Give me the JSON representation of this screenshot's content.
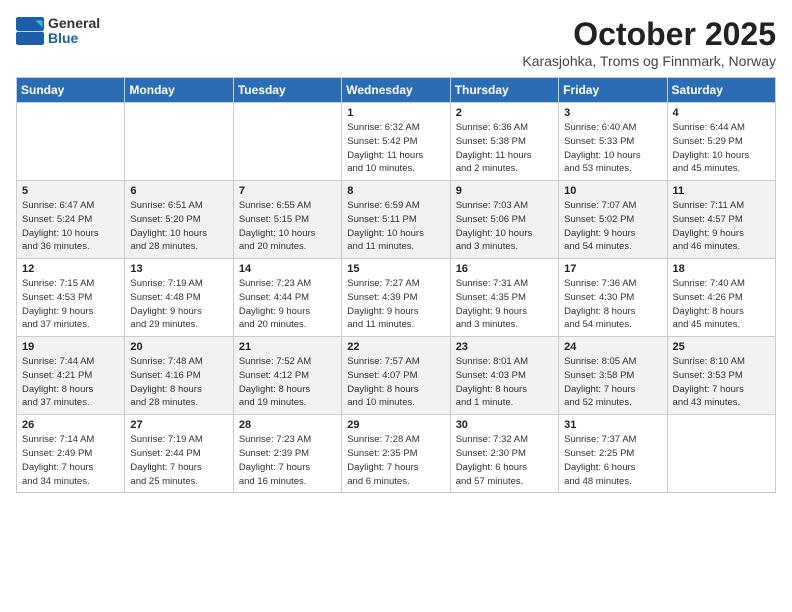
{
  "logo": {
    "general": "General",
    "blue": "Blue"
  },
  "title": "October 2025",
  "subtitle": "Karasjohka, Troms og Finnmark, Norway",
  "days_header": [
    "Sunday",
    "Monday",
    "Tuesday",
    "Wednesday",
    "Thursday",
    "Friday",
    "Saturday"
  ],
  "weeks": [
    [
      {
        "num": "",
        "detail": ""
      },
      {
        "num": "",
        "detail": ""
      },
      {
        "num": "",
        "detail": ""
      },
      {
        "num": "1",
        "detail": "Sunrise: 6:32 AM\nSunset: 5:42 PM\nDaylight: 11 hours\nand 10 minutes."
      },
      {
        "num": "2",
        "detail": "Sunrise: 6:36 AM\nSunset: 5:38 PM\nDaylight: 11 hours\nand 2 minutes."
      },
      {
        "num": "3",
        "detail": "Sunrise: 6:40 AM\nSunset: 5:33 PM\nDaylight: 10 hours\nand 53 minutes."
      },
      {
        "num": "4",
        "detail": "Sunrise: 6:44 AM\nSunset: 5:29 PM\nDaylight: 10 hours\nand 45 minutes."
      }
    ],
    [
      {
        "num": "5",
        "detail": "Sunrise: 6:47 AM\nSunset: 5:24 PM\nDaylight: 10 hours\nand 36 minutes."
      },
      {
        "num": "6",
        "detail": "Sunrise: 6:51 AM\nSunset: 5:20 PM\nDaylight: 10 hours\nand 28 minutes."
      },
      {
        "num": "7",
        "detail": "Sunrise: 6:55 AM\nSunset: 5:15 PM\nDaylight: 10 hours\nand 20 minutes."
      },
      {
        "num": "8",
        "detail": "Sunrise: 6:59 AM\nSunset: 5:11 PM\nDaylight: 10 hours\nand 11 minutes."
      },
      {
        "num": "9",
        "detail": "Sunrise: 7:03 AM\nSunset: 5:06 PM\nDaylight: 10 hours\nand 3 minutes."
      },
      {
        "num": "10",
        "detail": "Sunrise: 7:07 AM\nSunset: 5:02 PM\nDaylight: 9 hours\nand 54 minutes."
      },
      {
        "num": "11",
        "detail": "Sunrise: 7:11 AM\nSunset: 4:57 PM\nDaylight: 9 hours\nand 46 minutes."
      }
    ],
    [
      {
        "num": "12",
        "detail": "Sunrise: 7:15 AM\nSunset: 4:53 PM\nDaylight: 9 hours\nand 37 minutes."
      },
      {
        "num": "13",
        "detail": "Sunrise: 7:19 AM\nSunset: 4:48 PM\nDaylight: 9 hours\nand 29 minutes."
      },
      {
        "num": "14",
        "detail": "Sunrise: 7:23 AM\nSunset: 4:44 PM\nDaylight: 9 hours\nand 20 minutes."
      },
      {
        "num": "15",
        "detail": "Sunrise: 7:27 AM\nSunset: 4:39 PM\nDaylight: 9 hours\nand 11 minutes."
      },
      {
        "num": "16",
        "detail": "Sunrise: 7:31 AM\nSunset: 4:35 PM\nDaylight: 9 hours\nand 3 minutes."
      },
      {
        "num": "17",
        "detail": "Sunrise: 7:36 AM\nSunset: 4:30 PM\nDaylight: 8 hours\nand 54 minutes."
      },
      {
        "num": "18",
        "detail": "Sunrise: 7:40 AM\nSunset: 4:26 PM\nDaylight: 8 hours\nand 45 minutes."
      }
    ],
    [
      {
        "num": "19",
        "detail": "Sunrise: 7:44 AM\nSunset: 4:21 PM\nDaylight: 8 hours\nand 37 minutes."
      },
      {
        "num": "20",
        "detail": "Sunrise: 7:48 AM\nSunset: 4:16 PM\nDaylight: 8 hours\nand 28 minutes."
      },
      {
        "num": "21",
        "detail": "Sunrise: 7:52 AM\nSunset: 4:12 PM\nDaylight: 8 hours\nand 19 minutes."
      },
      {
        "num": "22",
        "detail": "Sunrise: 7:57 AM\nSunset: 4:07 PM\nDaylight: 8 hours\nand 10 minutes."
      },
      {
        "num": "23",
        "detail": "Sunrise: 8:01 AM\nSunset: 4:03 PM\nDaylight: 8 hours\nand 1 minute."
      },
      {
        "num": "24",
        "detail": "Sunrise: 8:05 AM\nSunset: 3:58 PM\nDaylight: 7 hours\nand 52 minutes."
      },
      {
        "num": "25",
        "detail": "Sunrise: 8:10 AM\nSunset: 3:53 PM\nDaylight: 7 hours\nand 43 minutes."
      }
    ],
    [
      {
        "num": "26",
        "detail": "Sunrise: 7:14 AM\nSunset: 2:49 PM\nDaylight: 7 hours\nand 34 minutes."
      },
      {
        "num": "27",
        "detail": "Sunrise: 7:19 AM\nSunset: 2:44 PM\nDaylight: 7 hours\nand 25 minutes."
      },
      {
        "num": "28",
        "detail": "Sunrise: 7:23 AM\nSunset: 2:39 PM\nDaylight: 7 hours\nand 16 minutes."
      },
      {
        "num": "29",
        "detail": "Sunrise: 7:28 AM\nSunset: 2:35 PM\nDaylight: 7 hours\nand 6 minutes."
      },
      {
        "num": "30",
        "detail": "Sunrise: 7:32 AM\nSunset: 2:30 PM\nDaylight: 6 hours\nand 57 minutes."
      },
      {
        "num": "31",
        "detail": "Sunrise: 7:37 AM\nSunset: 2:25 PM\nDaylight: 6 hours\nand 48 minutes."
      },
      {
        "num": "",
        "detail": ""
      }
    ]
  ]
}
